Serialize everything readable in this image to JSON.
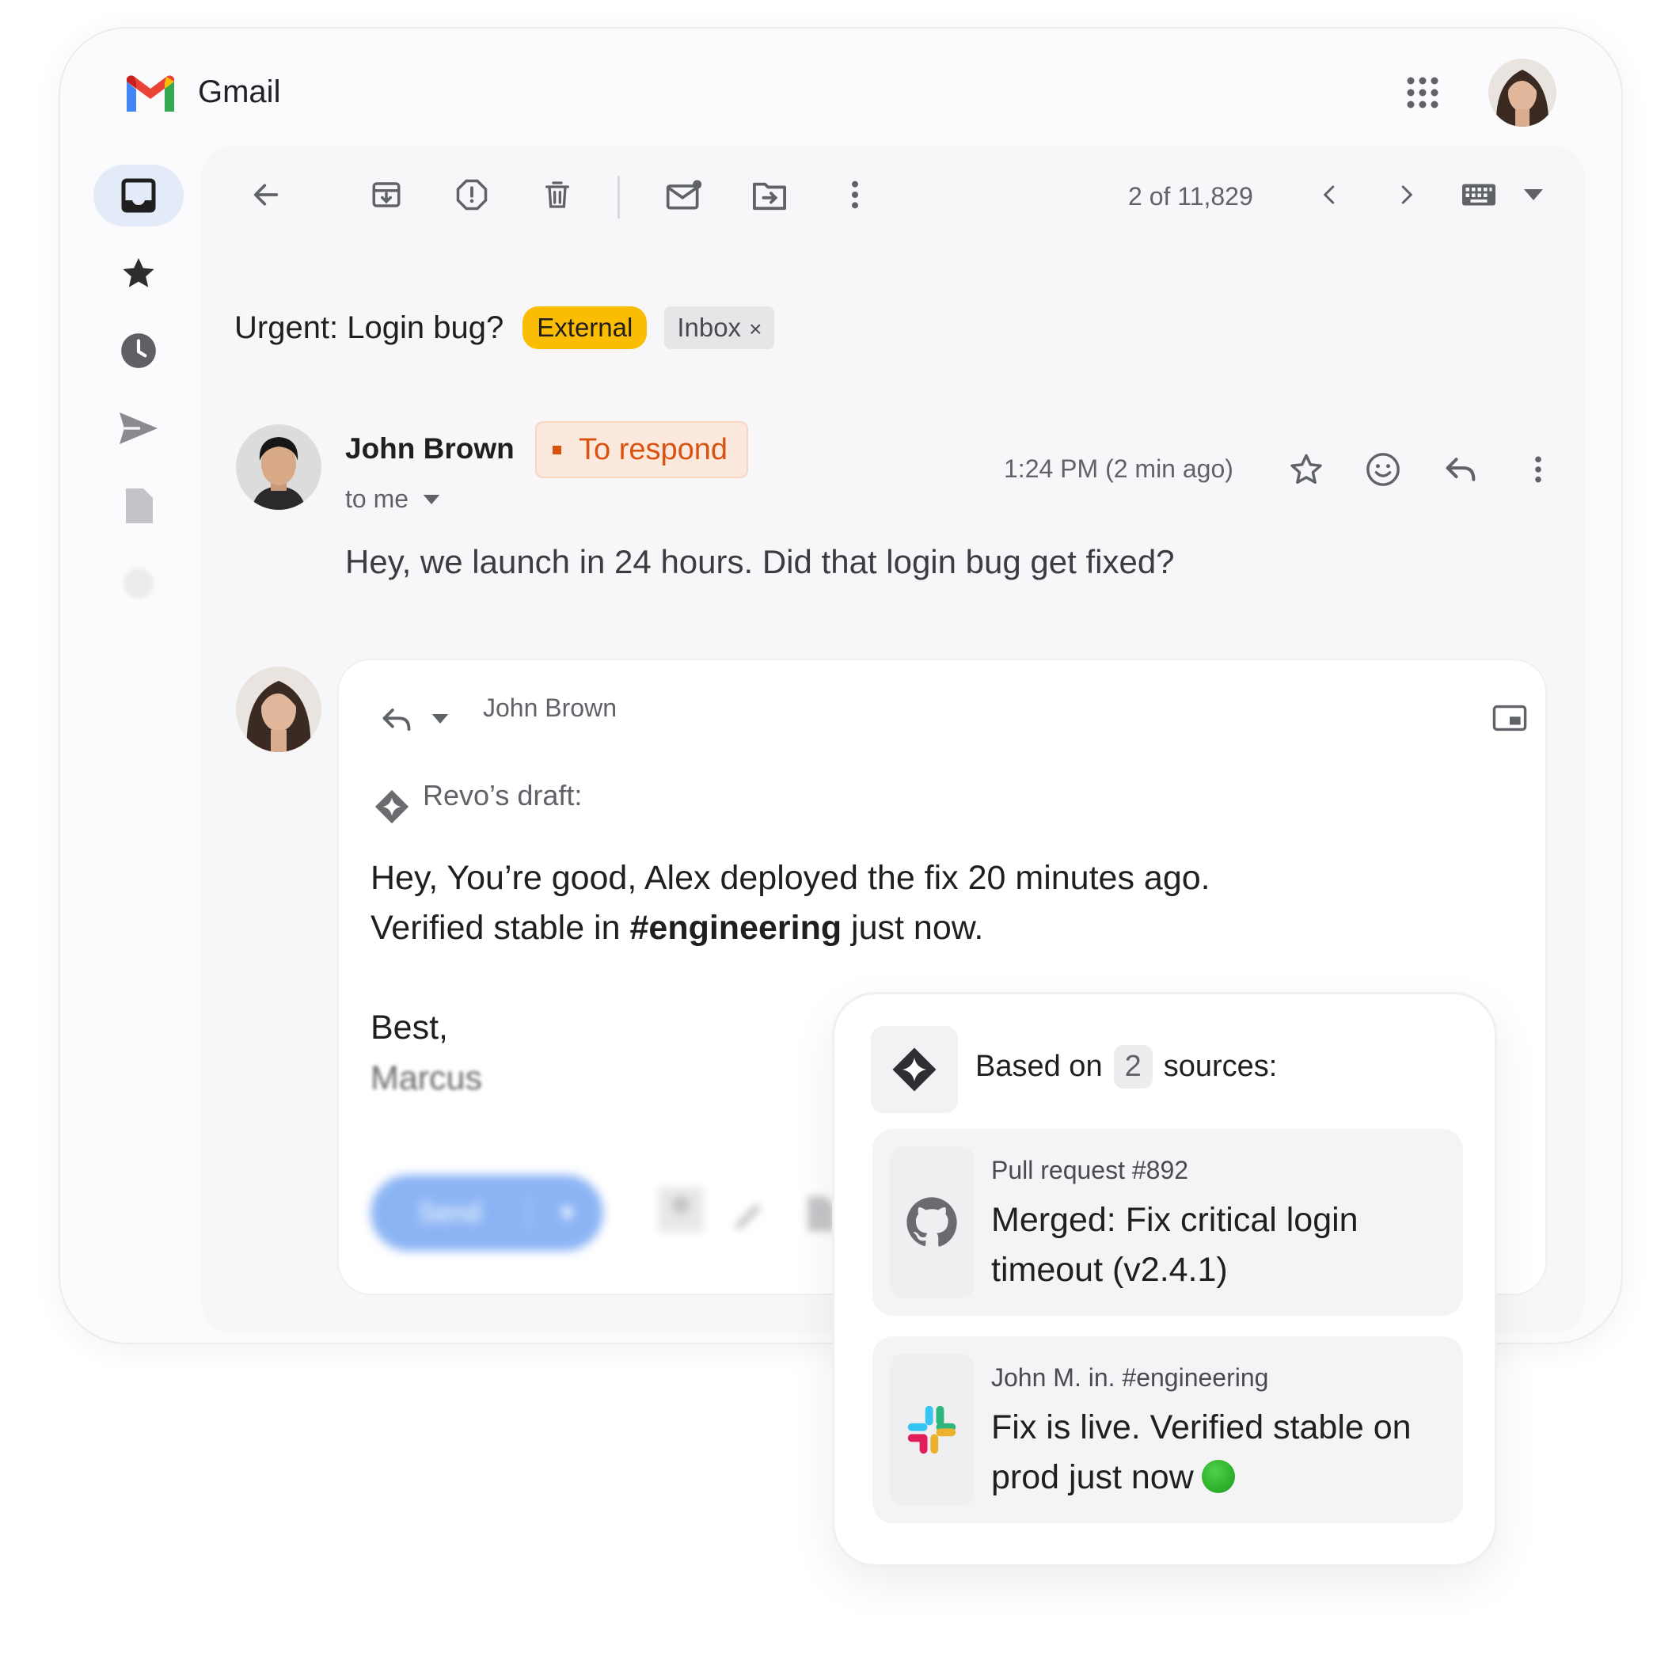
{
  "app": {
    "title": "Gmail"
  },
  "toolbar": {
    "pager": "2 of 11,829"
  },
  "email": {
    "subject": "Urgent: Login bug?",
    "labels": {
      "external": "External",
      "inbox": "Inbox",
      "inbox_remove": "×"
    },
    "sender": "John Brown",
    "tag": "To respond",
    "to": "to me",
    "time": "1:24 PM (2 min ago)",
    "body": "Hey, we launch in 24 hours. Did that login bug get fixed?"
  },
  "reply": {
    "recipient": "John Brown",
    "draft_label": "Revo’s draft:",
    "line1": "Hey, You’re good, Alex deployed the fix 20 minutes ago.",
    "line2_prefix": "Verified stable in ",
    "line2_channel": "#engineering",
    "line2_suffix": " just now.",
    "sign_off": "Best,",
    "signature": "Marcus",
    "send_label": "Send"
  },
  "sources": {
    "title_prefix": "Based on",
    "count": "2",
    "title_suffix": "sources:",
    "items": [
      {
        "icon": "github-icon",
        "meta": "Pull request #892",
        "text": "Merged: Fix critical login timeout (v2.4.1)"
      },
      {
        "icon": "slack-icon",
        "meta": "John M. in. #engineering",
        "text": "Fix is live. Verified stable on prod just now"
      }
    ]
  },
  "colors": {
    "external_chip": "#fbbc04",
    "respond_tag": "#d9520f",
    "rail_active": "#e4ebf8"
  }
}
